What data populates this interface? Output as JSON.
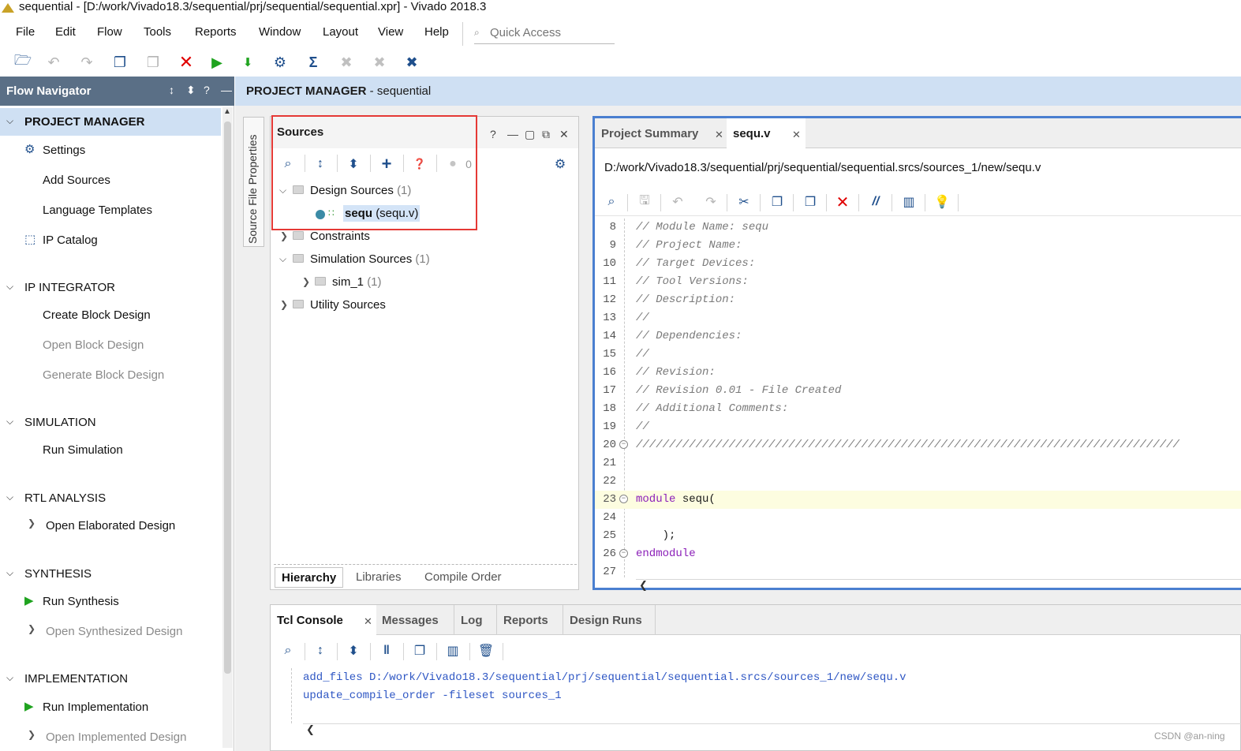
{
  "window": {
    "title": "sequential - [D:/work/Vivado18.3/sequential/prj/sequential/sequential.xpr] - Vivado 2018.3"
  },
  "menu": {
    "items": [
      "File",
      "Edit",
      "Flow",
      "Tools",
      "Reports",
      "Window",
      "Layout",
      "View",
      "Help"
    ],
    "quick_access_placeholder": "Quick Access"
  },
  "toolbar": {
    "icons": [
      "open-project-icon",
      "undo-icon",
      "redo-icon",
      "copy-icon",
      "paste-icon",
      "cancel-icon",
      "run-icon",
      "program-device-icon",
      "settings-icon",
      "sigma-icon",
      "disabled-tool-icon-1",
      "disabled-tool-icon-2",
      "debug-icon"
    ],
    "colors": {
      "cancel": "#e00000",
      "run": "#1fa31f",
      "accent": "#1f4f8c"
    }
  },
  "flow_navigator": {
    "title": "Flow Navigator",
    "sections": [
      {
        "label": "PROJECT MANAGER",
        "items": [
          {
            "label": "Settings",
            "icon": "gear-icon",
            "enabled": true
          },
          {
            "label": "Add Sources",
            "enabled": true
          },
          {
            "label": "Language Templates",
            "enabled": true
          },
          {
            "label": "IP Catalog",
            "icon": "ip-catalog-icon",
            "enabled": true
          }
        ]
      },
      {
        "label": "IP INTEGRATOR",
        "items": [
          {
            "label": "Create Block Design",
            "enabled": true
          },
          {
            "label": "Open Block Design",
            "enabled": false
          },
          {
            "label": "Generate Block Design",
            "enabled": false
          }
        ]
      },
      {
        "label": "SIMULATION",
        "items": [
          {
            "label": "Run Simulation",
            "enabled": true
          }
        ]
      },
      {
        "label": "RTL ANALYSIS",
        "items": [
          {
            "label": "Open Elaborated Design",
            "enabled": true
          }
        ]
      },
      {
        "label": "SYNTHESIS",
        "items": [
          {
            "label": "Run Synthesis",
            "icon": "play-icon",
            "enabled": true
          },
          {
            "label": "Open Synthesized Design",
            "enabled": false
          }
        ]
      },
      {
        "label": "IMPLEMENTATION",
        "items": [
          {
            "label": "Run Implementation",
            "icon": "play-icon",
            "enabled": true
          },
          {
            "label": "Open Implemented Design",
            "enabled": false
          }
        ]
      }
    ]
  },
  "project_manager": {
    "title_bold": "PROJECT MANAGER",
    "title_rest": " - sequential"
  },
  "side_tab": {
    "label": "Source File Properties"
  },
  "sources": {
    "title": "Sources",
    "error_count": "0",
    "tree": {
      "design_sources": {
        "label": "Design Sources",
        "count": "(1)"
      },
      "sequ": {
        "name": "sequ",
        "file": "(sequ.v)"
      },
      "constraints": {
        "label": "Constraints"
      },
      "simulation_sources": {
        "label": "Simulation Sources",
        "count": "(1)"
      },
      "sim_1": {
        "label": "sim_1",
        "count": "(1)"
      },
      "utility_sources": {
        "label": "Utility Sources"
      }
    },
    "tabs": [
      "Hierarchy",
      "Libraries",
      "Compile Order"
    ]
  },
  "editor": {
    "tabs": [
      {
        "label": "Project Summary"
      },
      {
        "label": "sequ.v"
      }
    ],
    "path": "D:/work/Vivado18.3/sequential/prj/sequential/sequential.srcs/sources_1/new/sequ.v",
    "lines": [
      {
        "n": "8",
        "text": "// Module Name: sequ"
      },
      {
        "n": "9",
        "text": "// Project Name:"
      },
      {
        "n": "10",
        "text": "// Target Devices:"
      },
      {
        "n": "11",
        "text": "// Tool Versions:"
      },
      {
        "n": "12",
        "text": "// Description:"
      },
      {
        "n": "13",
        "text": "//"
      },
      {
        "n": "14",
        "text": "// Dependencies:"
      },
      {
        "n": "15",
        "text": "//"
      },
      {
        "n": "16",
        "text": "// Revision:"
      },
      {
        "n": "17",
        "text": "// Revision 0.01 - File Created"
      },
      {
        "n": "18",
        "text": "// Additional Comments:"
      },
      {
        "n": "19",
        "text": "//"
      },
      {
        "n": "20",
        "text": "//////////////////////////////////////////////////////////////////////////////////"
      },
      {
        "n": "21",
        "text": ""
      },
      {
        "n": "22",
        "text": ""
      },
      {
        "n": "23",
        "kw": "module",
        "text": " sequ("
      },
      {
        "n": "24",
        "text": ""
      },
      {
        "n": "25",
        "text": "    );"
      },
      {
        "n": "26",
        "kw": "endmodule",
        "text": ""
      },
      {
        "n": "27",
        "text": ""
      }
    ]
  },
  "console": {
    "tabs": [
      "Tcl Console",
      "Messages",
      "Log",
      "Reports",
      "Design Runs"
    ],
    "lines": [
      "add_files D:/work/Vivado18.3/sequential/prj/sequential/sequential.srcs/sources_1/new/sequ.v",
      "update_compile_order -fileset sources_1"
    ]
  },
  "watermark": "CSDN @an-ning"
}
